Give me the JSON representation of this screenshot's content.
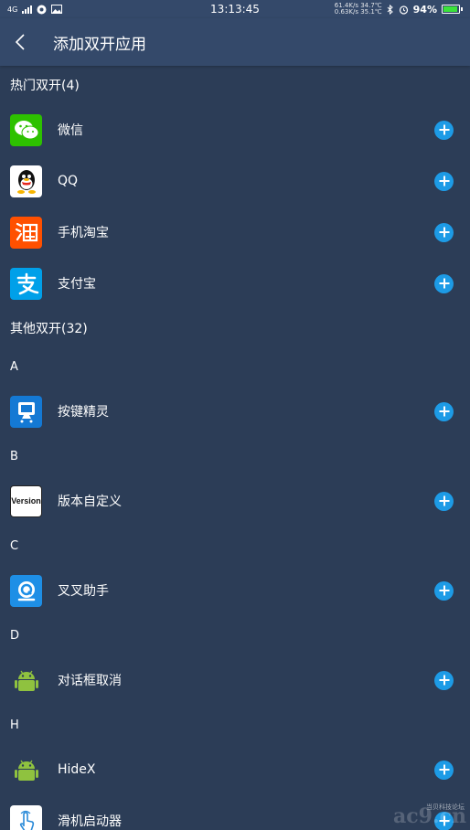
{
  "status_bar": {
    "network": "4G",
    "time": "13:13:45",
    "speed_up": "61.4K/s 34.7℃",
    "speed_down": "0.63K/s 35.1℃",
    "battery": "94%",
    "battery_level": 0.94
  },
  "app_bar": {
    "title": "添加双开应用"
  },
  "hot_section": {
    "title": "热门双开(4)",
    "apps": [
      {
        "name": "微信",
        "icon": "wechat-icon"
      },
      {
        "name": "QQ",
        "icon": "qq-icon"
      },
      {
        "name": "手机淘宝",
        "icon": "taobao-icon"
      },
      {
        "name": "支付宝",
        "icon": "alipay-icon"
      }
    ]
  },
  "other_section": {
    "title": "其他双开(32)",
    "groups": [
      {
        "letter": "A",
        "apps": [
          {
            "name": "按键精灵",
            "icon": "monitor-icon"
          }
        ]
      },
      {
        "letter": "B",
        "apps": [
          {
            "name": "版本自定义",
            "icon": "version-diy-icon",
            "icon_text": "Version"
          }
        ]
      },
      {
        "letter": "C",
        "apps": [
          {
            "name": "叉叉助手",
            "icon": "xx-assistant-icon"
          }
        ]
      },
      {
        "letter": "D",
        "apps": [
          {
            "name": "对话框取消",
            "icon": "android-icon"
          }
        ]
      },
      {
        "letter": "H",
        "apps": [
          {
            "name": "HideX",
            "icon": "android-icon"
          },
          {
            "name": "滑机启动器",
            "icon": "touch-hand-icon"
          }
        ]
      }
    ]
  },
  "watermark": {
    "main": "ac9.cn",
    "sub": "当贝科技论坛"
  },
  "colors": {
    "background": "#2c3d57",
    "app_bar": "#34496a",
    "add_button": "#1d9be6",
    "battery": "#3be23b"
  }
}
